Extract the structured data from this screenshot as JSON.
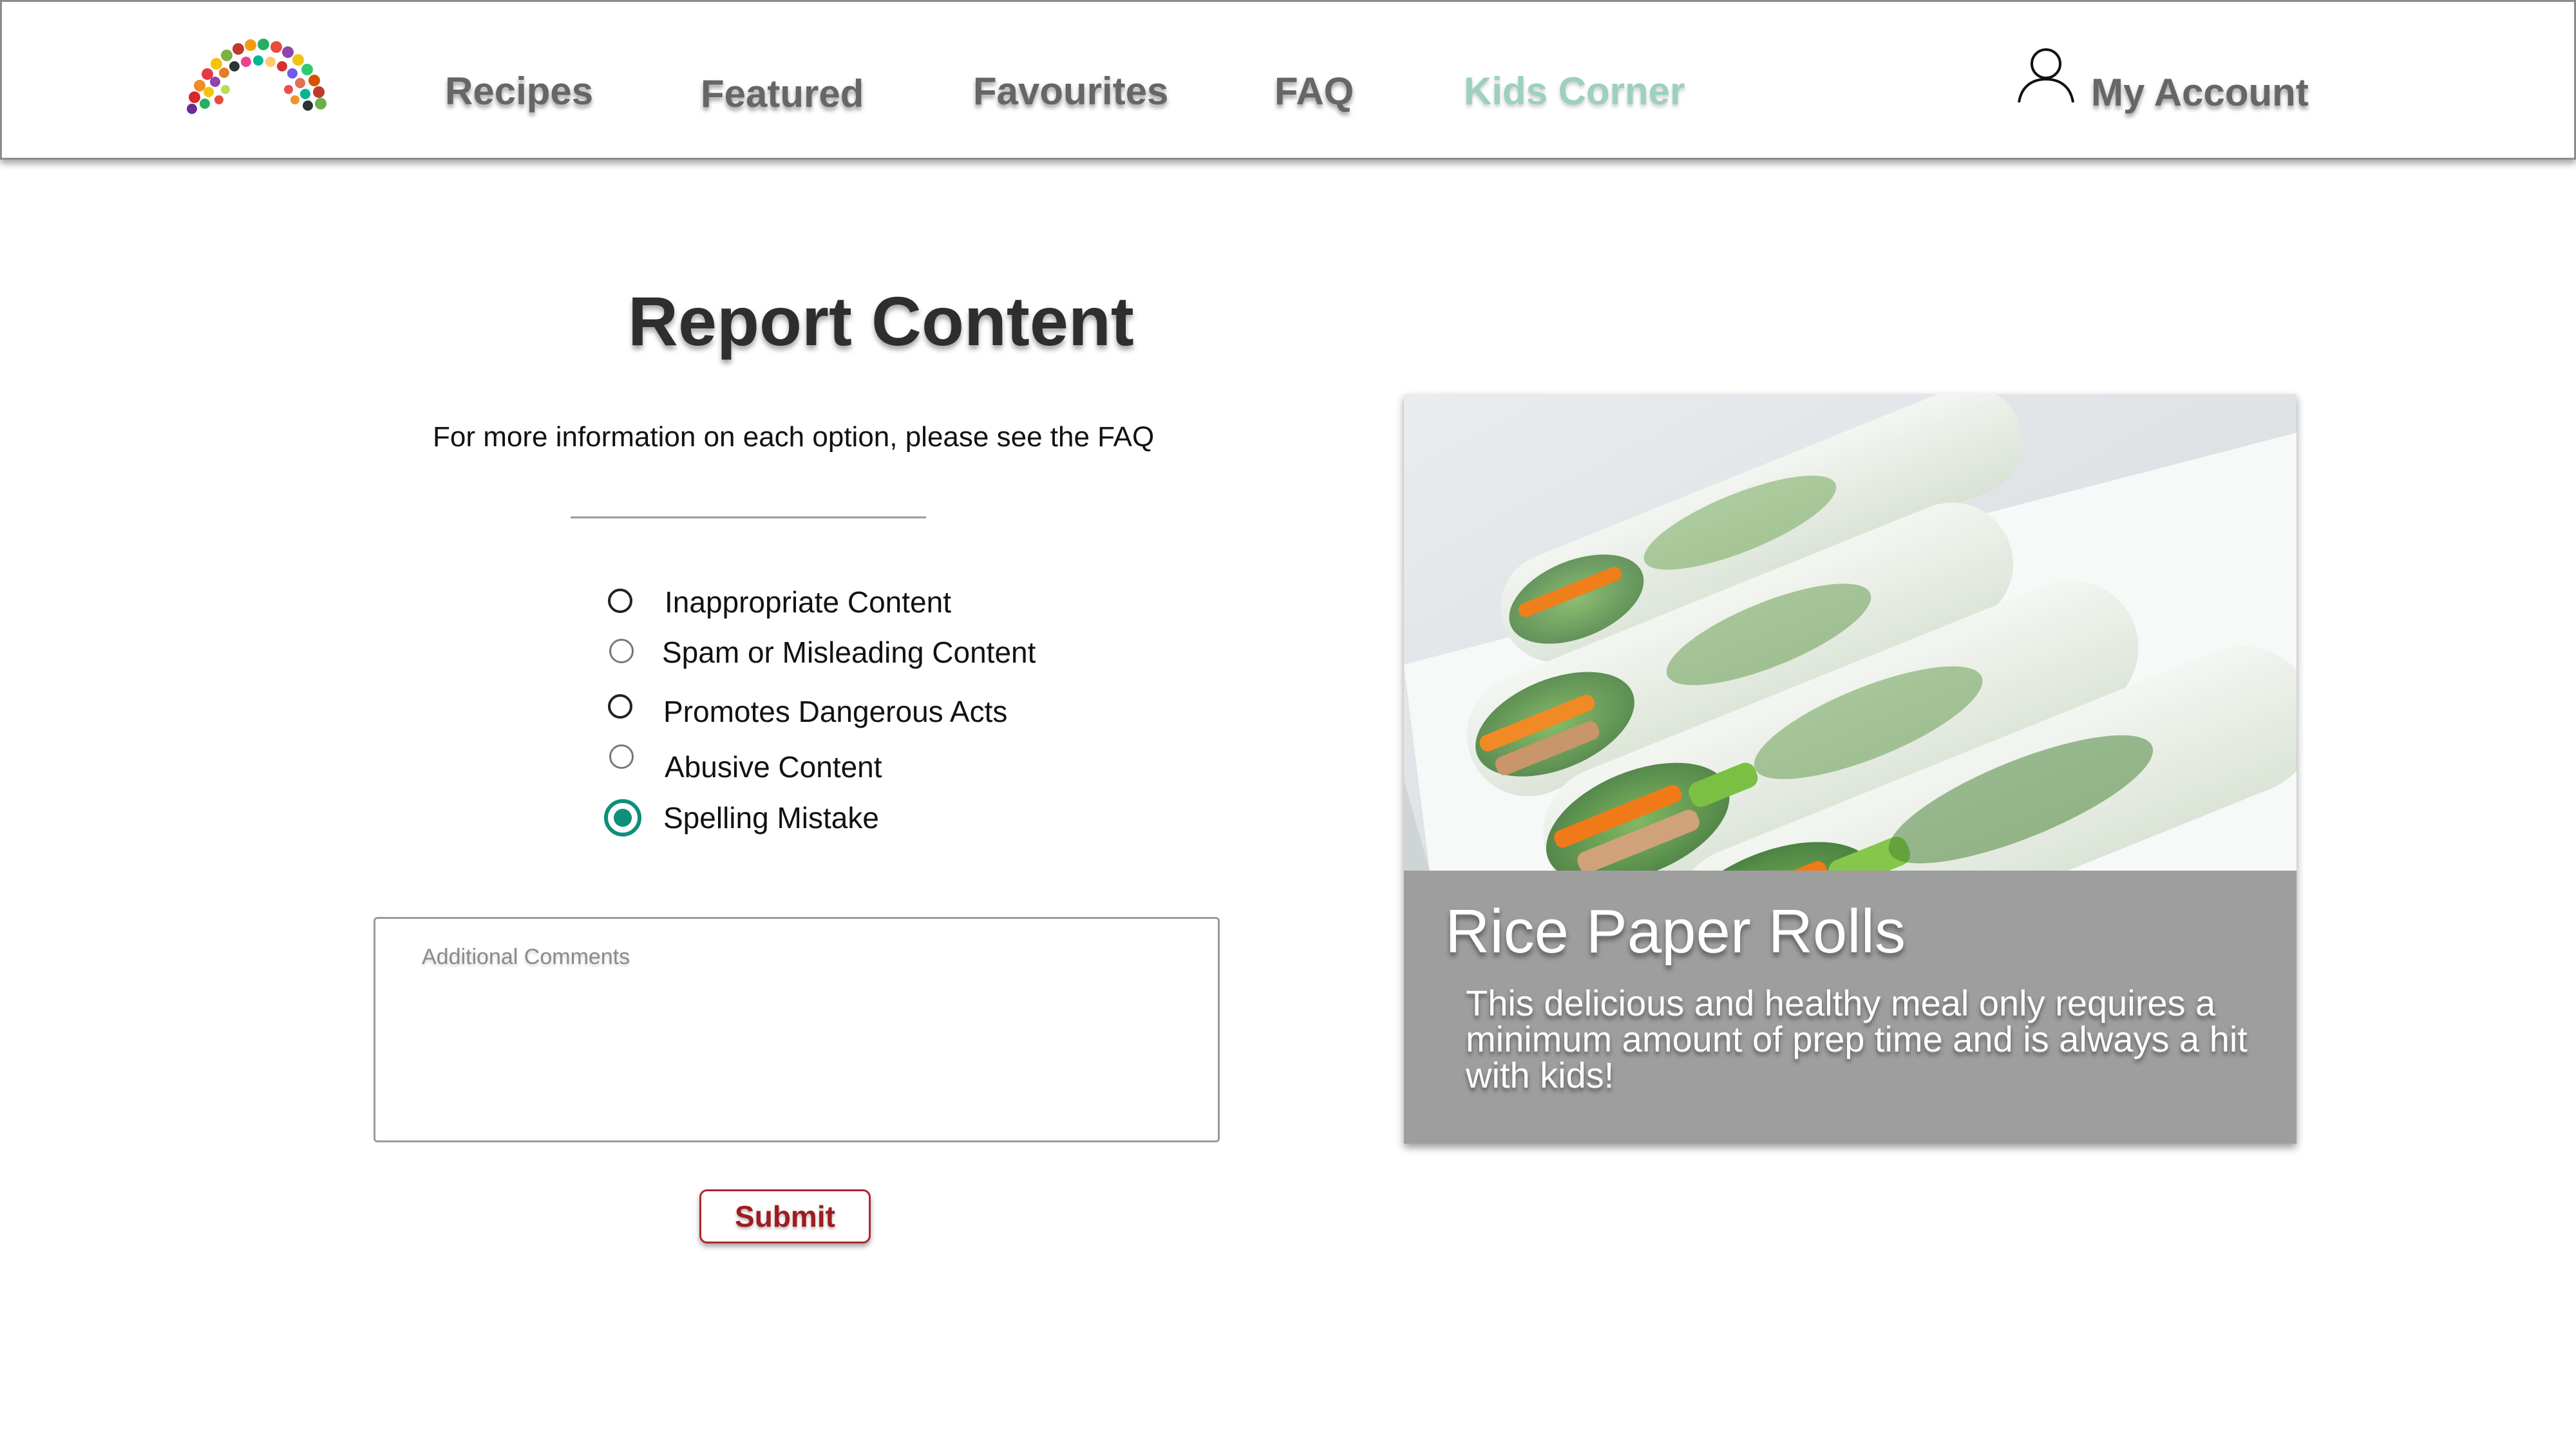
{
  "nav": {
    "logo_icon": "rainbow-fruit-logo-icon",
    "items": [
      {
        "label": "Recipes"
      },
      {
        "label": "Featured"
      },
      {
        "label": "Favourites"
      },
      {
        "label": "FAQ"
      },
      {
        "label": "Kids Corner",
        "active": true,
        "color": "#9dd0bd"
      }
    ],
    "account_label": "My Account",
    "account_icon": "user-icon"
  },
  "form": {
    "title": "Report Content",
    "info": "For more information on each option, please see the FAQ",
    "options": [
      {
        "label": "Inappropriate Content",
        "selected": false
      },
      {
        "label": "Spam or Misleading Content",
        "selected": false
      },
      {
        "label": "Promotes Dangerous Acts",
        "selected": false
      },
      {
        "label": "Abusive Content",
        "selected": false
      },
      {
        "label": "Spelling Mistake",
        "selected": true
      }
    ],
    "comments_placeholder": "Additional Comments",
    "comments_value": "",
    "submit_label": "Submit",
    "accent_color": "#0e8f7a",
    "submit_color": "#a01b20"
  },
  "card": {
    "image": "rice-paper-rolls-photo",
    "title": "Rice Paper Rolls",
    "description": "This delicious and healthy meal only requires a minimum amount of prep time and is always a hit with kids!"
  }
}
